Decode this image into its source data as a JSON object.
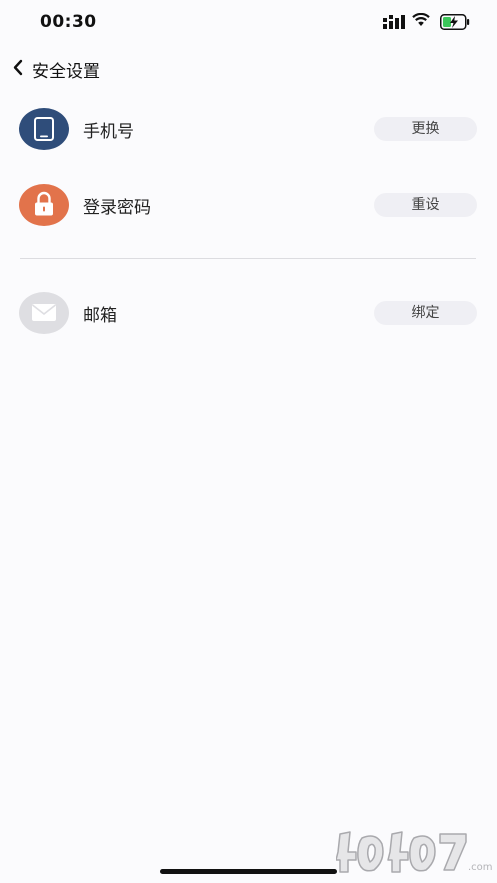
{
  "status_bar": {
    "time": "00:30",
    "icons": [
      "signal-icon",
      "wifi-icon",
      "battery-charging-icon"
    ]
  },
  "nav": {
    "back_icon": "chevron-left-icon",
    "title": "安全设置"
  },
  "rows": [
    {
      "label": "手机号",
      "action": "更换",
      "icon": "phone-icon",
      "icon_color": "#2f4d7a"
    },
    {
      "label": "登录密码",
      "action": "重设",
      "icon": "lock-icon",
      "icon_color": "#e2734b"
    },
    {
      "label": "邮箱",
      "action": "绑定",
      "icon": "mail-icon",
      "icon_color": "#dedee2"
    }
  ],
  "watermark": {
    "text": "4o4o7.com"
  },
  "colors": {
    "background": "#fbfbfd",
    "action_button_bg": "#efeff4",
    "divider": "#dcdce0"
  }
}
